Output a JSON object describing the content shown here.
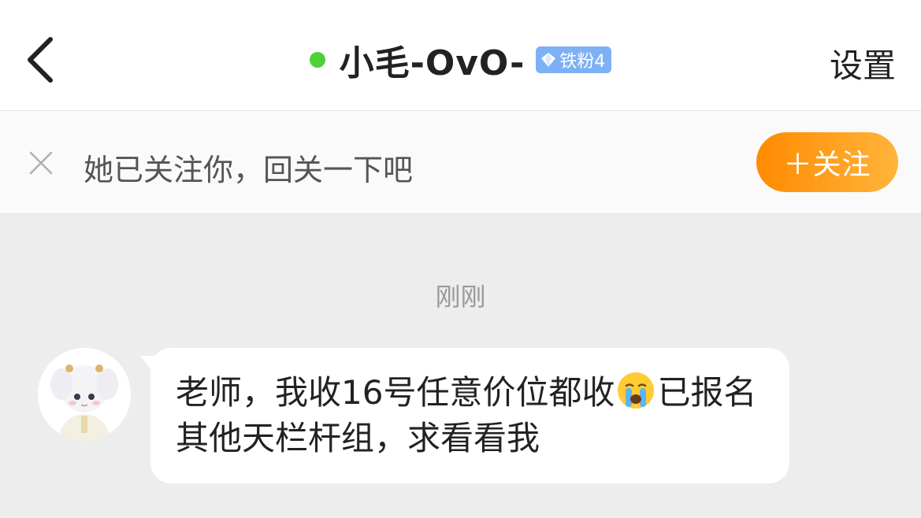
{
  "header": {
    "title": "小毛-OvO-",
    "fan_badge": "铁粉4",
    "settings_label": "设置",
    "online_color": "#4cd137",
    "badge_color": "#7eb0f5"
  },
  "follow_bar": {
    "text": "她已关注你，回关一下吧",
    "follow_button": "＋关注",
    "button_gradient": [
      "#ff8a00",
      "#ffb43a"
    ]
  },
  "chat": {
    "timestamp": "刚刚",
    "message": {
      "text_before": "老师，我收16号任意价位都收",
      "emoji": "loudly-crying-face",
      "text_after": "已报名其他天栏杆组，求看看我"
    }
  }
}
